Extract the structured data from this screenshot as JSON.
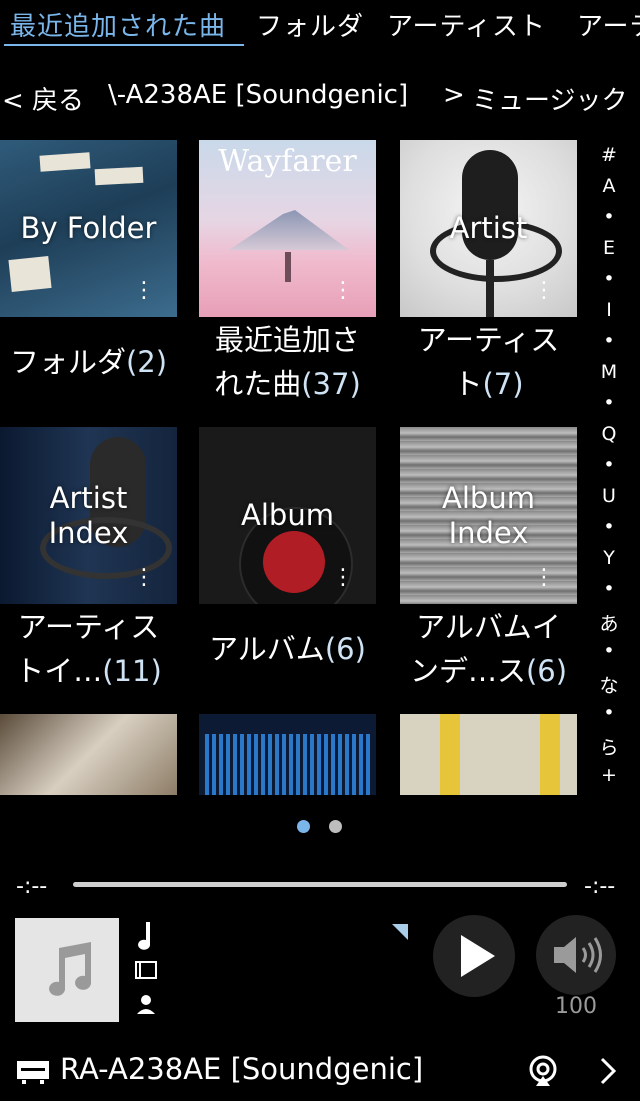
{
  "tabs": [
    "最近追加された曲",
    "フォルダ",
    "アーティスト",
    "アーテ"
  ],
  "breadcrumb": {
    "back": "< 戻る",
    "server": "\\-A238AE [Soundgenic]",
    "sep": ">",
    "current": "ミュージック"
  },
  "tiles": [
    {
      "overlay": "By Folder",
      "label": "フォルダ",
      "count": "(2)"
    },
    {
      "overlay": "Wayfarer",
      "label": "最近追加さ",
      "label2": "れた曲",
      "count": "(37)"
    },
    {
      "overlay": "Artist",
      "label": "アーティス",
      "label2": "ト",
      "count": "(7)"
    },
    {
      "overlay": "Artist",
      "overlay2": "Index",
      "label": "アーティス",
      "label2": "トイ…",
      "count": "(11)"
    },
    {
      "overlay": "Album",
      "label": "アルバム",
      "count": "(6)"
    },
    {
      "overlay": "Album",
      "overlay2": "Index",
      "label": "アルバムイ",
      "label2": "ンデ…ス",
      "count": "(6)"
    }
  ],
  "index_rail": [
    "#",
    "A",
    "•",
    "E",
    "•",
    "I",
    "•",
    "M",
    "•",
    "Q",
    "•",
    "U",
    "•",
    "Y",
    "•",
    "あ",
    "•",
    "な",
    "•",
    "ら",
    "+"
  ],
  "progress": {
    "elapsed": "-:--",
    "remaining": "-:--"
  },
  "volume": "100",
  "device": {
    "name": "RA-A238AE [Soundgenic]"
  },
  "colors": {
    "accent": "#7ab6ea",
    "background": "#000000",
    "count": "#cfe3f5"
  },
  "icons": [
    "music-note-icon",
    "note-icon",
    "album-icon",
    "artist-icon",
    "play-icon",
    "speaker-icon",
    "device-icon",
    "airplay-icon",
    "chevron-right-icon"
  ]
}
